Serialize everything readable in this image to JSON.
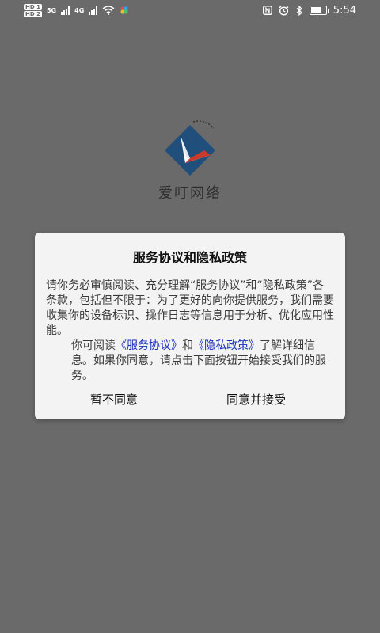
{
  "status_bar": {
    "sim_labels": [
      "HD 1",
      "HD 2"
    ],
    "network_labels": [
      "5G",
      "4G"
    ],
    "time": "5:54",
    "battery_level": 0.75
  },
  "app": {
    "name": "爱叮网络"
  },
  "dialog": {
    "title": "服务协议和隐私政策",
    "paragraph1": "请你务必审慎阅读、充分理解“服务协议”和“隐私政策”各条款，包括但不限于：为了更好的向你提供服务，我们需要收集你的设备标识、操作日志等信息用于分析、优化应用性能。",
    "p2_prefix": "你可阅读",
    "service_link": "《服务协议》",
    "p2_and": "和",
    "privacy_link": "《隐私政策》",
    "p2_suffix": "了解详细信息。如果你同意，请点击下面按钮开始接受我们的服务。",
    "decline_label": "暂不同意",
    "accept_label": "同意并接受"
  },
  "colors": {
    "overlay_background": "#6a6a6a",
    "dialog_background": "#f3f3f3",
    "link": "#1a2fbf",
    "logo_blue": "#1f4f7a",
    "logo_red": "#c83a2a"
  },
  "icons": [
    "nfc-icon",
    "alarm-icon",
    "bluetooth-icon",
    "battery-icon",
    "wifi-icon",
    "signal-icon"
  ]
}
